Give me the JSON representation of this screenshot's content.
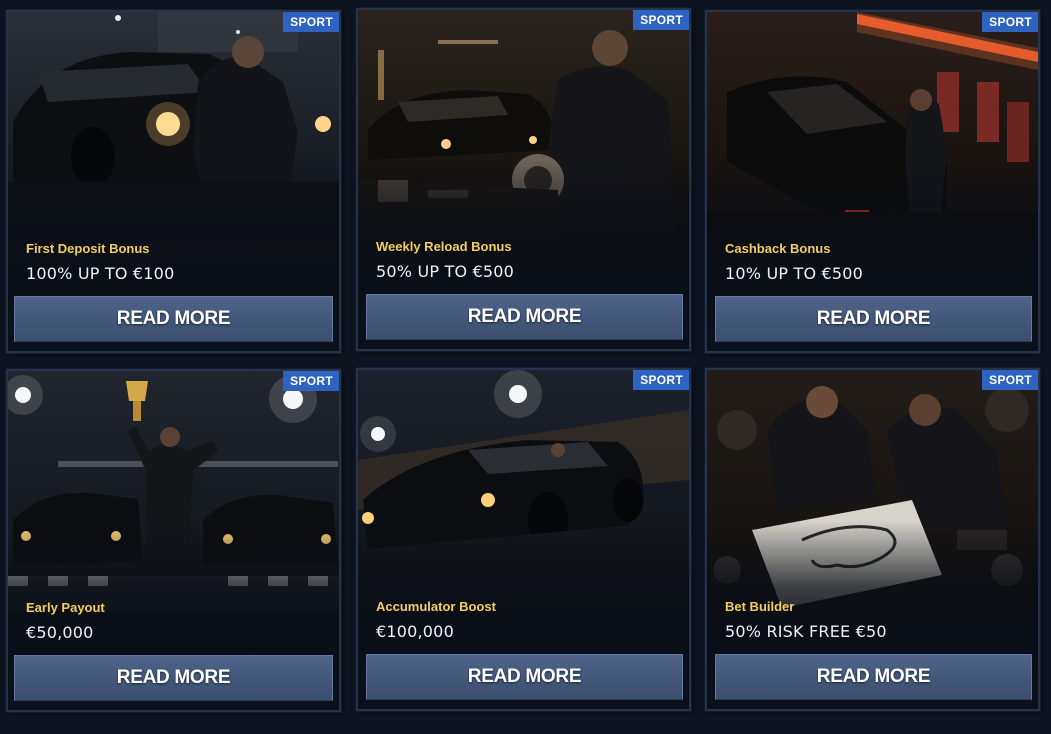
{
  "promotions": [
    {
      "badge": "SPORT",
      "title": "First Deposit Bonus",
      "value": "100% UP TO €100",
      "button_label": "READ MORE",
      "image": "man-kneeling-by-black-muscle-car"
    },
    {
      "badge": "SPORT",
      "title": "Weekly Reload Bonus",
      "value": "50% UP TO €500",
      "button_label": "READ MORE",
      "image": "mechanic-holding-turbocharger-in-garage"
    },
    {
      "badge": "SPORT",
      "title": "Cashback Bonus",
      "value": "10% UP TO €500",
      "button_label": "READ MORE",
      "image": "man-refueling-car-at-gas-station"
    },
    {
      "badge": "SPORT",
      "title": "Early Payout",
      "value": "€50,000",
      "button_label": "READ MORE",
      "image": "driver-raising-trophy-between-two-cars"
    },
    {
      "badge": "SPORT",
      "title": "Accumulator Boost",
      "value": "€100,000",
      "button_label": "READ MORE",
      "image": "black-muscle-car-racing-in-stadium"
    },
    {
      "badge": "SPORT",
      "title": "Bet Builder",
      "value": "50% RISK FREE €50",
      "button_label": "READ MORE",
      "image": "two-men-studying-race-track-map"
    }
  ],
  "colors": {
    "badge": "#2f63c2",
    "title": "#f1cf63",
    "button": "#46597d",
    "background": "#0e1521"
  }
}
